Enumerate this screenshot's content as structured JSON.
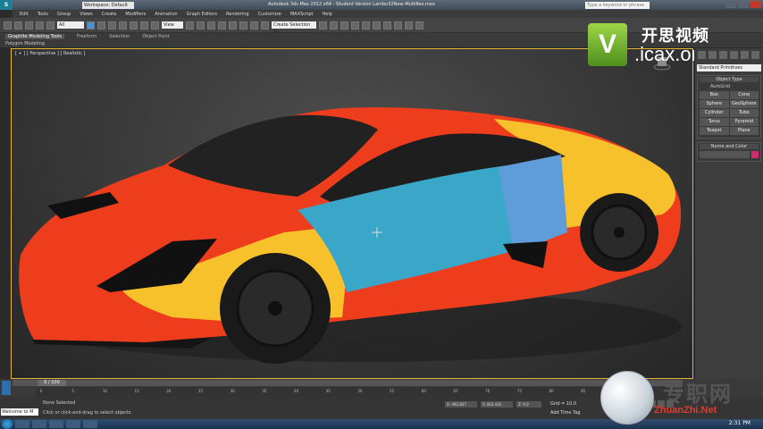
{
  "window": {
    "app_icon_letter": "S",
    "workspace": "Workspace: Default",
    "title": "Autodesk 3ds Max  2012 x64    - Student Version     Lambo32New-MultiRes.max",
    "help_search_placeholder": "Type a keyword or phrase"
  },
  "menu": [
    "Edit",
    "Tools",
    "Group",
    "Views",
    "Create",
    "Modifiers",
    "Animation",
    "Graph Editors",
    "Rendering",
    "Customize",
    "MAXScript",
    "Help"
  ],
  "toolbar": {
    "selection_filter": "All",
    "reference_coord": "View",
    "named_selection": "Create Selection Se"
  },
  "ribbon": {
    "tabs": [
      "Graphite Modeling Tools",
      "Freeform",
      "Selection",
      "Object Paint"
    ],
    "active_tab": "Graphite Modeling Tools",
    "sub_label": "Polygon Modeling"
  },
  "viewport": {
    "label": "[ + ] [ Perspective ] [ Realistic ]"
  },
  "watermark_top": {
    "logo_letter": "V",
    "chinese": "开思视频",
    "site": ".icax.org"
  },
  "command_panel": {
    "category": "Standard Primitives",
    "object_type_title": "Object Type",
    "autogrid_label": "AutoGrid",
    "primitives": [
      "Box",
      "Cone",
      "Sphere",
      "GeoSphere",
      "Cylinder",
      "Tube",
      "Torus",
      "Pyramid",
      "Teapot",
      "Plane"
    ],
    "name_color_title": "Name and Color",
    "swatch_color": "#d12a6f"
  },
  "timeline": {
    "frame_display": "0 / 100",
    "ticks": [
      "0",
      "5",
      "10",
      "15",
      "20",
      "25",
      "30",
      "35",
      "40",
      "45",
      "50",
      "55",
      "60",
      "65",
      "70",
      "75",
      "80",
      "85",
      "90",
      "95",
      "100"
    ]
  },
  "status": {
    "maxscript_text": "Welcome to M",
    "selection_text": "None Selected",
    "prompt_text": "Click or click-and-drag to select objects",
    "x_value": "X: 492.847",
    "y_value": "Y: 403.416",
    "z_value": "Z: 0.0",
    "grid_text": "Grid = 10.0",
    "add_time_tag": "Add Time Tag"
  },
  "taskbar": {
    "clock": "2:31 PM"
  },
  "watermark_bottom": {
    "chinese": "专职网",
    "english": "ZhuanZhi.Net"
  }
}
